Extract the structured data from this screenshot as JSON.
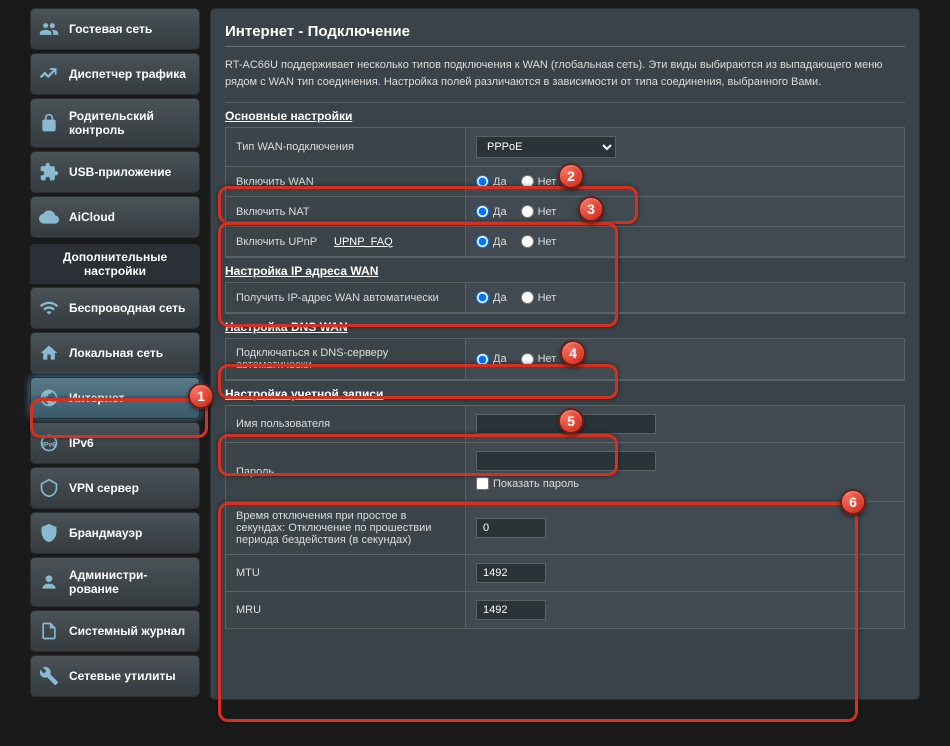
{
  "sidebar": {
    "nav1": [
      {
        "label": "Гостевая сеть"
      },
      {
        "label": "Диспетчер трафика"
      },
      {
        "label": "Родительский контроль"
      },
      {
        "label": "USB-приложение"
      },
      {
        "label": "AiCloud"
      }
    ],
    "section_header": "Дополнительные настройки",
    "nav2": [
      {
        "label": "Беспроводная сеть"
      },
      {
        "label": "Локальная сеть"
      },
      {
        "label": "Интернет"
      },
      {
        "label": "IPv6"
      },
      {
        "label": "VPN сервер"
      },
      {
        "label": "Брандмауэр"
      },
      {
        "label": "Администри-рование"
      },
      {
        "label": "Системный журнал"
      },
      {
        "label": "Сетевые утилиты"
      }
    ]
  },
  "main": {
    "title": "Интернет - Подключение",
    "desc": "RT-AC66U поддерживает несколько типов подключения к WAN (глобальная сеть). Эти виды выбираются из выпадающего меню рядом с WAN тип соединения. Настройка полей различаются в зависимости от типа соединения, выбранного Вами.",
    "sections": {
      "basic": "Основные настройки",
      "wan_ip": "Настройка IP адреса WAN",
      "dns": "Настройка DNS WAN",
      "account": "Настройка учетной записи"
    },
    "labels": {
      "type": "Тип WAN-подключения",
      "enable_wan": "Включить WAN",
      "enable_nat": "Включить NAT",
      "enable_upnp": "Включить UPnP",
      "upnp_faq": "UPNP_FAQ",
      "auto_ip": "Получить IP-адрес WAN автоматически",
      "auto_dns": "Подключаться к DNS-серверу автоматически",
      "username": "Имя пользователя",
      "password": "Пароль",
      "show_password": "Показать пароль",
      "idle": "Время отключения при простое в секундах: Отключение по прошествии периода бездействия (в секундах)",
      "mtu": "MTU",
      "mru": "MRU"
    },
    "radio": {
      "yes": "Да",
      "no": "Нет"
    },
    "values": {
      "type": "PPPoE",
      "idle": "0",
      "mtu": "1492",
      "mru": "1492"
    }
  },
  "badges": {
    "b1": "1",
    "b2": "2",
    "b3": "3",
    "b4": "4",
    "b5": "5",
    "b6": "6"
  }
}
